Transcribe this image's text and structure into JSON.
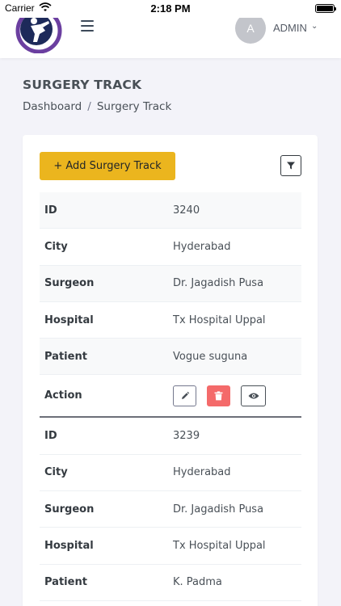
{
  "status_bar": {
    "carrier": "Carrier",
    "time": "2:18 PM"
  },
  "header": {
    "user_initial": "A",
    "user_name": "ADMIN"
  },
  "page": {
    "title": "SURGERY TRACK",
    "breadcrumb": [
      "Dashboard",
      "Surgery Track"
    ]
  },
  "toolbar": {
    "add_label": "+ Add Surgery Track"
  },
  "records": [
    {
      "fields": [
        {
          "label": "ID",
          "value": "3240"
        },
        {
          "label": "City",
          "value": "Hyderabad"
        },
        {
          "label": "Surgeon",
          "value": "Dr. Jagadish Pusa"
        },
        {
          "label": "Hospital",
          "value": "Tx Hospital Uppal"
        },
        {
          "label": "Patient",
          "value": "Vogue suguna"
        }
      ],
      "action_label": "Action"
    },
    {
      "fields": [
        {
          "label": "ID",
          "value": "3239"
        },
        {
          "label": "City",
          "value": "Hyderabad"
        },
        {
          "label": "Surgeon",
          "value": "Dr. Jagadish Pusa"
        },
        {
          "label": "Hospital",
          "value": "Tx Hospital Uppal"
        },
        {
          "label": "Patient",
          "value": "K. Padma"
        }
      ]
    }
  ],
  "icons": {
    "menu": "hamburger-menu-icon",
    "filter": "filter-icon",
    "edit": "pencil-icon",
    "delete": "trash-icon",
    "view": "eye-icon"
  },
  "colors": {
    "accent": "#ebb51e",
    "danger": "#f46a6a",
    "logo": "#6b3fa0"
  }
}
